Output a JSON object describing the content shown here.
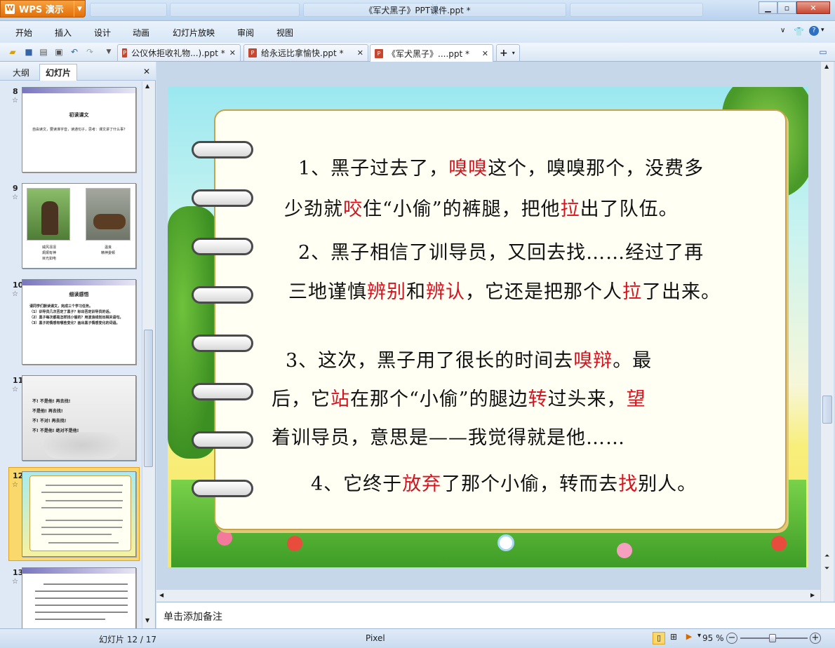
{
  "app": {
    "wps_button": "WPS 演示",
    "window_title": "《军犬黑子》PPT课件.ppt *"
  },
  "menu": [
    "开始",
    "插入",
    "设计",
    "动画",
    "幻灯片放映",
    "审阅",
    "视图"
  ],
  "tabs": [
    {
      "label": "公仪休拒收礼物...).ppt *"
    },
    {
      "label": "给永远比拿愉快.ppt *"
    },
    {
      "label": "《军犬黑子》....ppt *"
    }
  ],
  "panel": {
    "tab_outline": "大纲",
    "tab_slides": "幻灯片"
  },
  "thumbnails": {
    "s8": {
      "num": "8",
      "title": "初读课文",
      "text": "自由读文，要读准字音，读通句子，思考：课文讲了什么事？"
    },
    "s9": {
      "num": "9",
      "cap1a": "威风凛凛",
      "cap1b": "炯炯有神",
      "cap1c": "目光如电",
      "cap2a": "温良",
      "cap2b": "精神委顿"
    },
    "s10": {
      "num": "10",
      "title": "细读感悟",
      "l1": "请同学们默读课文，完成三个学习任务。",
      "l2": "（1）训导员几次否定了黑子？标出否定训导员的话。",
      "l3": "（2）黑子每次都是怎样找小偷的？用波浪线划出相关语句。",
      "l4": "（3）黑子的情感有哪些变化？画出黑子情感变化的词语。"
    },
    "s11": {
      "num": "11",
      "l1": "不! 不是他! 再去找!",
      "l2": "不是他! 再去找!",
      "l3": "不! 不对! 再去找!",
      "l4": "不! 不是他! 绝对不是他!"
    },
    "s12": {
      "num": "12"
    },
    "s13": {
      "num": "13"
    }
  },
  "slide": {
    "p1": [
      [
        {
          "t": "1、黑子过去了，"
        },
        {
          "t": "嗅嗅",
          "r": true
        },
        {
          "t": "这个，嗅嗅那个，没费多"
        }
      ],
      [
        {
          "t": "少劲就"
        },
        {
          "t": "咬",
          "r": true
        },
        {
          "t": "住“小偷”的裤腿，把他"
        },
        {
          "t": "拉",
          "r": true
        },
        {
          "t": "出了队伍。"
        }
      ]
    ],
    "p2": [
      [
        {
          "t": "2、黑子相信了训导员，又回去找……经过了再"
        }
      ],
      [
        {
          "t": "三地谨慎"
        },
        {
          "t": "辨别",
          "r": true
        },
        {
          "t": "和"
        },
        {
          "t": "辨认",
          "r": true
        },
        {
          "t": "，它还是把那个人"
        },
        {
          "t": "拉",
          "r": true
        },
        {
          "t": "了出来。"
        }
      ]
    ],
    "p3": [
      [
        {
          "t": "3、这次，黑子用了很长的时间去"
        },
        {
          "t": "嗅辩",
          "r": true
        },
        {
          "t": "。最"
        }
      ],
      [
        {
          "t": "后，它"
        },
        {
          "t": "站",
          "r": true
        },
        {
          "t": "在那个“小偷”的腿边"
        },
        {
          "t": "转",
          "r": true
        },
        {
          "t": "过头来，"
        },
        {
          "t": "望",
          "r": true
        }
      ],
      [
        {
          "t": "着训导员，意思是——我觉得就是他……"
        }
      ]
    ],
    "p4": [
      [
        {
          "t": "4、它终于"
        },
        {
          "t": "放弃",
          "r": true
        },
        {
          "t": "了那个小偷，转而去"
        },
        {
          "t": "找",
          "r": true
        },
        {
          "t": "别人。"
        }
      ]
    ]
  },
  "notes_placeholder": "单击添加备注",
  "status": {
    "slide_counter": "幻灯片 12 / 17",
    "theme": "Pixel",
    "zoom": "95 %"
  },
  "colors": {
    "highlight_red": "#d8121f",
    "accent_orange": "#e2700a"
  }
}
